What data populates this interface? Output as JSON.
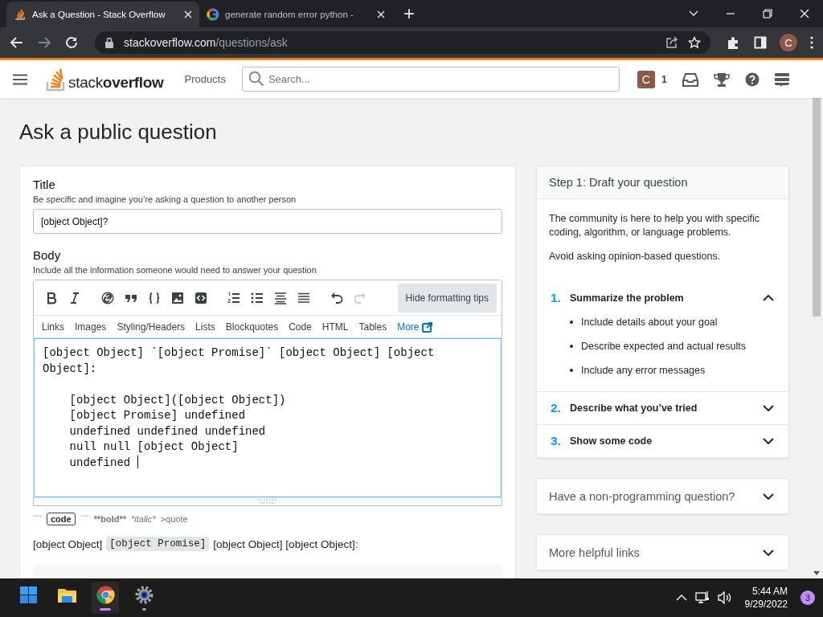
{
  "browser": {
    "tabs": [
      {
        "title": "Ask a Question - Stack Overflow",
        "kind": "stack",
        "selected": true
      },
      {
        "title": "generate random error python -",
        "kind": "google",
        "selected": false
      }
    ],
    "new_tab": "+",
    "url": {
      "host": "stackoverflow.com",
      "path": "/questions/ask"
    },
    "profile": "C"
  },
  "site_header": {
    "logo": {
      "part1": "stack",
      "part2": "overflow"
    },
    "products": "Products",
    "search": {
      "placeholder": "Search..."
    },
    "avatar": "C",
    "reputation": "1"
  },
  "page_title": "Ask a public question",
  "form": {
    "title": {
      "label": "Title",
      "hint": "Be specific and imagine you’re asking a question to another person",
      "value": "[object Object]?"
    },
    "body": {
      "label": "Body",
      "hint": "Include all the information someone would need to answer your question",
      "toolbar": [
        {
          "buttons": [
            {
              "kind": "bold",
              "disabled": false
            },
            {
              "kind": "italic",
              "disabled": false
            }
          ]
        },
        {
          "buttons": [
            {
              "kind": "link",
              "disabled": false
            },
            {
              "kind": "quote",
              "disabled": false
            },
            {
              "kind": "braces",
              "disabled": false
            },
            {
              "kind": "image",
              "disabled": false
            },
            {
              "kind": "snippet",
              "disabled": false
            }
          ]
        },
        {
          "buttons": [
            {
              "kind": "ordered-list",
              "disabled": false
            },
            {
              "kind": "bullet-list",
              "disabled": false
            },
            {
              "kind": "heading",
              "disabled": false
            },
            {
              "kind": "rule",
              "disabled": false
            }
          ]
        },
        {
          "buttons": [
            {
              "kind": "undo",
              "disabled": false
            },
            {
              "kind": "redo",
              "disabled": true
            }
          ]
        }
      ],
      "tips_button": "Hide formatting tips",
      "help_tabs": [
        {
          "label": "Links",
          "kind": "tab"
        },
        {
          "label": "Images",
          "kind": "tab"
        },
        {
          "label": "Styling/Headers",
          "kind": "tab"
        },
        {
          "label": "Lists",
          "kind": "tab"
        },
        {
          "label": "Blockquotes",
          "kind": "tab"
        },
        {
          "label": "Code",
          "kind": "tab"
        },
        {
          "label": "HTML",
          "kind": "tab"
        },
        {
          "label": "Tables",
          "kind": "tab"
        },
        {
          "label": "More",
          "kind": "external"
        }
      ],
      "value": "[object Object] `[object Promise]` [object Object] [object Object]:\n\n    [object Object]([object Object])\n    [object Promise] undefined\n    undefined undefined undefined\n    null null [object Object]\n    undefined ",
      "tips": [
        {
          "text": "```",
          "kind": "plain"
        },
        {
          "text": "code",
          "kind": "code"
        },
        {
          "text": "```",
          "kind": "plain"
        },
        {
          "text": "**bold**",
          "kind": "bold"
        },
        {
          "text": "*italic*",
          "kind": "italic"
        },
        {
          "text": ">quote",
          "kind": "plain"
        }
      ],
      "preview": [
        {
          "text": "[object Object]",
          "kind": "text"
        },
        {
          "text": "[object Promise]",
          "kind": "code"
        },
        {
          "text": "[object Object] [object Object]:",
          "kind": "text"
        }
      ]
    }
  },
  "sidebar": {
    "draft": {
      "title": "Step 1: Draft your question",
      "paragraphs": [
        "The community is here to help you with specific coding, algorithm, or language problems.",
        "Avoid asking opinion-based questions."
      ],
      "steps": [
        {
          "number": "1.",
          "title": "Summarize the problem",
          "expanded": true,
          "bullets": [
            "Include details about your goal",
            "Describe expected and actual results",
            "Include any error messages"
          ]
        },
        {
          "number": "2.",
          "title": "Describe what you’ve tried",
          "expanded": false
        },
        {
          "number": "3.",
          "title": "Show some code",
          "expanded": false
        }
      ]
    },
    "cards": [
      {
        "title": "Have a non-programming question?",
        "expanded": false
      },
      {
        "title": "More helpful links",
        "expanded": false
      }
    ]
  },
  "taskbar": {
    "apps": [
      {
        "kind": "start",
        "active": false,
        "running": false
      },
      {
        "kind": "files",
        "active": false,
        "running": false
      },
      {
        "kind": "chrome",
        "active": true,
        "running": true
      },
      {
        "kind": "settings",
        "active": false,
        "running": true
      }
    ],
    "time": "5:44 AM",
    "date": "9/29/2022",
    "notifications": "3"
  }
}
